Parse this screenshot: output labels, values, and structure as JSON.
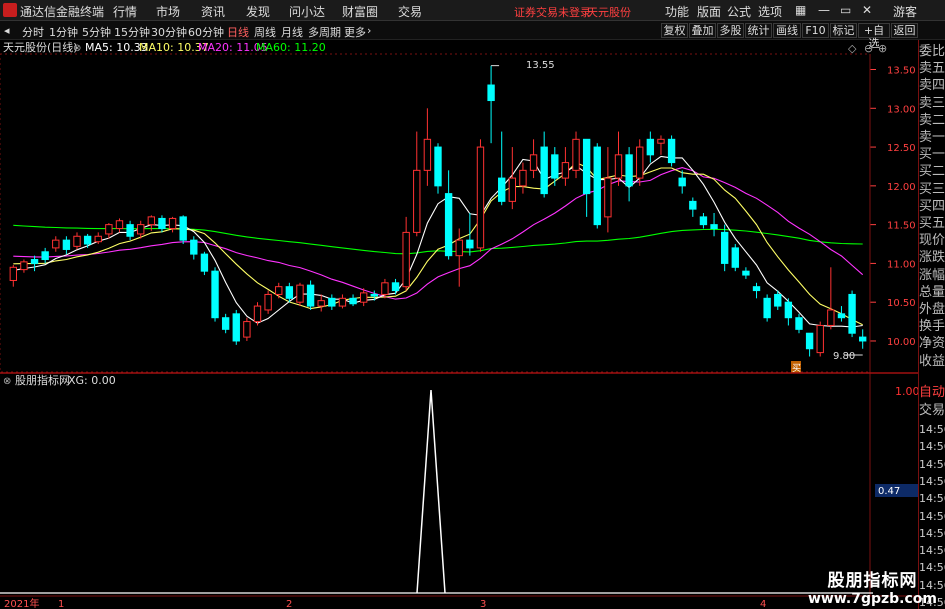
{
  "app": {
    "title": "通达信金融终端",
    "menus": [
      "行情",
      "市场",
      "资讯",
      "发现",
      "问小达",
      "财富圈",
      "交易"
    ],
    "notice": "证券交易未登录",
    "stock_top": "天元股份",
    "right_menus": [
      "功能",
      "版面",
      "公式",
      "选项"
    ],
    "guest": "游客"
  },
  "periods": [
    "分时",
    "1分钟",
    "5分钟",
    "15分钟",
    "30分钟",
    "60分钟",
    "日线",
    "周线",
    "月线",
    "多周期",
    "更多"
  ],
  "toolbar": [
    "复权",
    "叠加",
    "多股",
    "统计",
    "画线",
    "F10",
    "标记",
    "+自选",
    "返回"
  ],
  "ma_legend": {
    "stock": "天元股份(日线)",
    "ma5": "MA5: 10.33",
    "ma10": "MA10: 10.37",
    "ma20": "MA20: 11.05",
    "ma60": "MA60: 11.20"
  },
  "colors": {
    "up": "#ff3232",
    "down": "#00ffff",
    "ma5": "#ffffff",
    "ma10": "#ffff66",
    "ma20": "#ff33ff",
    "ma60": "#00ff00",
    "grid": "#7a1010"
  },
  "price_axis": [
    "13.50",
    "13.00",
    "12.50",
    "12.00",
    "11.50",
    "11.00",
    "10.50",
    "10.00"
  ],
  "annot": {
    "high": "13.55",
    "low": "9.80",
    "tag": "买"
  },
  "sub_legend": {
    "name": "股朋指标网",
    "value": "XG: 0.00"
  },
  "sub_axis": [
    "1.00"
  ],
  "sub_value": "0.47",
  "right_panel": [
    "委比",
    "卖五",
    "卖四",
    "卖三",
    "卖二",
    "卖一",
    "买一",
    "买二",
    "买三",
    "买四",
    "买五",
    "现价",
    "涨跌",
    "涨幅",
    "总量",
    "外盘",
    "换手",
    "净资",
    "收益"
  ],
  "right_panel2": [
    "自动",
    "交易"
  ],
  "times": [
    "14:56",
    "14:56",
    "14:56",
    "14:56",
    "14:56",
    "14:56",
    "14:56",
    "14:56",
    "14:56",
    "14:56",
    "14:56"
  ],
  "date_axis": [
    "2021年",
    "1",
    "2",
    "3",
    "4"
  ],
  "watermark": {
    "title": "股朋指标网",
    "url": "www.7gpzb.com"
  },
  "chart_data": {
    "type": "candlestick",
    "ylim": [
      9.6,
      13.7
    ],
    "candles": [
      [
        10.78,
        10.95,
        10.7,
        10.98
      ],
      [
        10.92,
        11.02,
        10.88,
        11.05
      ],
      [
        11.05,
        11.0,
        10.9,
        11.1
      ],
      [
        11.15,
        11.05,
        11.0,
        11.2
      ],
      [
        11.2,
        11.3,
        11.15,
        11.35
      ],
      [
        11.3,
        11.18,
        11.12,
        11.35
      ],
      [
        11.22,
        11.35,
        11.18,
        11.4
      ],
      [
        11.35,
        11.25,
        11.2,
        11.38
      ],
      [
        11.28,
        11.35,
        11.25,
        11.4
      ],
      [
        11.38,
        11.5,
        11.32,
        11.52
      ],
      [
        11.45,
        11.55,
        11.4,
        11.58
      ],
      [
        11.5,
        11.35,
        11.3,
        11.55
      ],
      [
        11.38,
        11.5,
        11.32,
        11.55
      ],
      [
        11.5,
        11.6,
        11.42,
        11.62
      ],
      [
        11.58,
        11.45,
        11.4,
        11.62
      ],
      [
        11.45,
        11.58,
        11.4,
        11.6
      ],
      [
        11.6,
        11.3,
        11.25,
        11.62
      ],
      [
        11.3,
        11.12,
        11.05,
        11.35
      ],
      [
        11.12,
        10.9,
        10.85,
        11.15
      ],
      [
        10.9,
        10.3,
        10.25,
        10.95
      ],
      [
        10.3,
        10.15,
        10.1,
        10.35
      ],
      [
        10.35,
        10.0,
        9.95,
        10.4
      ],
      [
        10.05,
        10.25,
        10.0,
        10.3
      ],
      [
        10.25,
        10.45,
        10.2,
        10.5
      ],
      [
        10.4,
        10.6,
        10.35,
        10.65
      ],
      [
        10.6,
        10.7,
        10.55,
        10.75
      ],
      [
        10.7,
        10.55,
        10.5,
        10.75
      ],
      [
        10.5,
        10.72,
        10.45,
        10.75
      ],
      [
        10.72,
        10.45,
        10.4,
        10.78
      ],
      [
        10.45,
        10.52,
        10.38,
        10.6
      ],
      [
        10.55,
        10.45,
        10.4,
        10.6
      ],
      [
        10.45,
        10.55,
        10.42,
        10.6
      ],
      [
        10.55,
        10.48,
        10.45,
        10.6
      ],
      [
        10.5,
        10.62,
        10.45,
        10.68
      ],
      [
        10.6,
        10.58,
        10.52,
        10.65
      ],
      [
        10.6,
        10.75,
        10.55,
        10.8
      ],
      [
        10.75,
        10.65,
        10.6,
        10.8
      ],
      [
        10.7,
        11.4,
        10.65,
        11.6
      ],
      [
        11.4,
        12.2,
        11.35,
        12.7
      ],
      [
        12.2,
        12.6,
        12.0,
        13.0
      ],
      [
        12.5,
        12.0,
        11.9,
        12.55
      ],
      [
        11.9,
        11.1,
        11.05,
        12.2
      ],
      [
        11.1,
        11.3,
        10.7,
        11.45
      ],
      [
        11.3,
        11.2,
        11.1,
        11.65
      ],
      [
        11.2,
        12.5,
        11.15,
        12.6
      ],
      [
        13.3,
        13.1,
        12.55,
        13.55
      ],
      [
        12.1,
        11.8,
        11.75,
        12.7
      ],
      [
        11.8,
        12.1,
        11.7,
        12.5
      ],
      [
        12.0,
        12.2,
        11.9,
        12.3
      ],
      [
        12.2,
        12.4,
        12.1,
        12.6
      ],
      [
        12.5,
        11.9,
        11.85,
        12.7
      ],
      [
        12.4,
        12.1,
        12.0,
        12.5
      ],
      [
        12.1,
        12.3,
        12.0,
        12.5
      ],
      [
        12.2,
        12.6,
        12.1,
        12.7
      ],
      [
        12.6,
        11.9,
        11.6,
        12.6
      ],
      [
        12.5,
        11.5,
        11.45,
        12.55
      ],
      [
        11.6,
        12.1,
        11.4,
        12.5
      ],
      [
        12.1,
        12.4,
        12.0,
        12.7
      ],
      [
        12.4,
        12.0,
        11.8,
        12.5
      ],
      [
        12.1,
        12.5,
        12.0,
        12.6
      ],
      [
        12.6,
        12.4,
        12.3,
        12.7
      ],
      [
        12.55,
        12.6,
        12.4,
        12.65
      ],
      [
        12.6,
        12.3,
        12.25,
        12.65
      ],
      [
        12.1,
        12.0,
        11.9,
        12.2
      ],
      [
        11.8,
        11.7,
        11.6,
        11.85
      ],
      [
        11.6,
        11.5,
        11.45,
        11.65
      ],
      [
        11.5,
        11.45,
        11.35,
        11.65
      ],
      [
        11.4,
        11.0,
        10.9,
        11.5
      ],
      [
        11.2,
        10.95,
        10.9,
        11.25
      ],
      [
        10.9,
        10.85,
        10.8,
        10.95
      ],
      [
        10.7,
        10.65,
        10.55,
        10.75
      ],
      [
        10.55,
        10.3,
        10.25,
        10.6
      ],
      [
        10.6,
        10.45,
        10.4,
        10.65
      ],
      [
        10.5,
        10.3,
        10.2,
        10.55
      ],
      [
        10.3,
        10.15,
        10.1,
        10.35
      ],
      [
        10.1,
        9.9,
        9.8,
        10.1
      ],
      [
        9.85,
        10.2,
        9.8,
        10.25
      ],
      [
        10.2,
        10.4,
        10.15,
        10.95
      ],
      [
        10.35,
        10.3,
        10.25,
        10.45
      ],
      [
        10.6,
        10.1,
        10.05,
        10.65
      ],
      [
        10.05,
        10.0,
        9.9,
        10.15
      ]
    ]
  }
}
